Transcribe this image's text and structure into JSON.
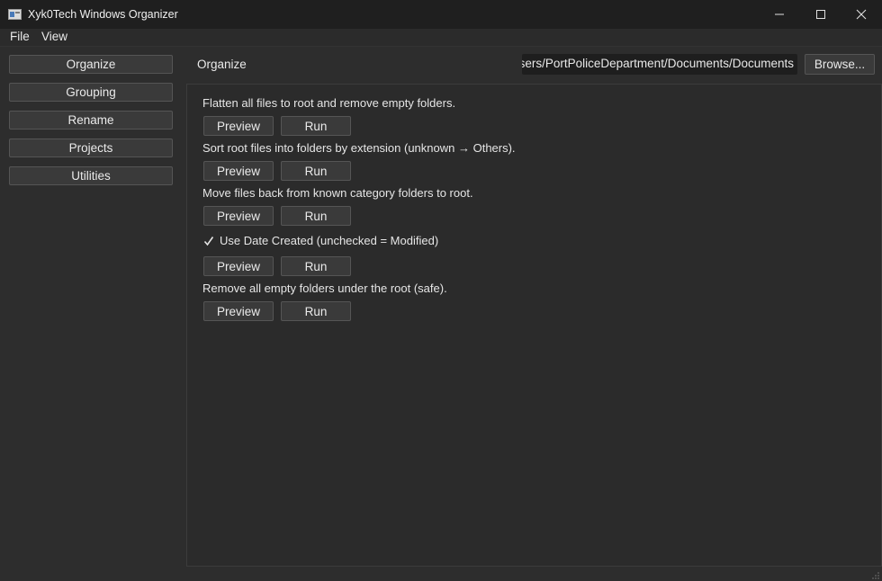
{
  "window": {
    "title": "Xyk0Tech Windows Organizer"
  },
  "menu": {
    "file": "File",
    "view": "View"
  },
  "sidebar": {
    "items": [
      {
        "label": "Organize"
      },
      {
        "label": "Grouping"
      },
      {
        "label": "Rename"
      },
      {
        "label": "Projects"
      },
      {
        "label": "Utilities"
      }
    ]
  },
  "header": {
    "section_title": "Organize",
    "path": "C:/Users/PortPoliceDepartment/Documents/Documents",
    "browse_label": "Browse..."
  },
  "operations": [
    {
      "description": "Flatten all files to root and remove empty folders.",
      "preview_label": "Preview",
      "run_label": "Run"
    },
    {
      "description": "Sort root files into folders by extension (unknown → Others).",
      "preview_label": "Preview",
      "run_label": "Run"
    },
    {
      "description": "Move files back from known category folders to root.",
      "preview_label": "Preview",
      "run_label": "Run"
    },
    {
      "checkbox_label": "Use Date Created (unchecked = Modified)",
      "checked": true,
      "preview_label": "Preview",
      "run_label": "Run"
    },
    {
      "description": "Remove all empty folders under the root (safe).",
      "preview_label": "Preview",
      "run_label": "Run"
    }
  ],
  "icons": {
    "app": "app-window-icon",
    "minimize": "minimize-icon",
    "maximize": "maximize-icon",
    "close": "close-icon",
    "check": "checkmark-icon"
  },
  "colors": {
    "titlebar": "#1f1f1f",
    "body": "#2d2d2d",
    "button": "#3a3a3a",
    "text": "#e6e6e6"
  }
}
